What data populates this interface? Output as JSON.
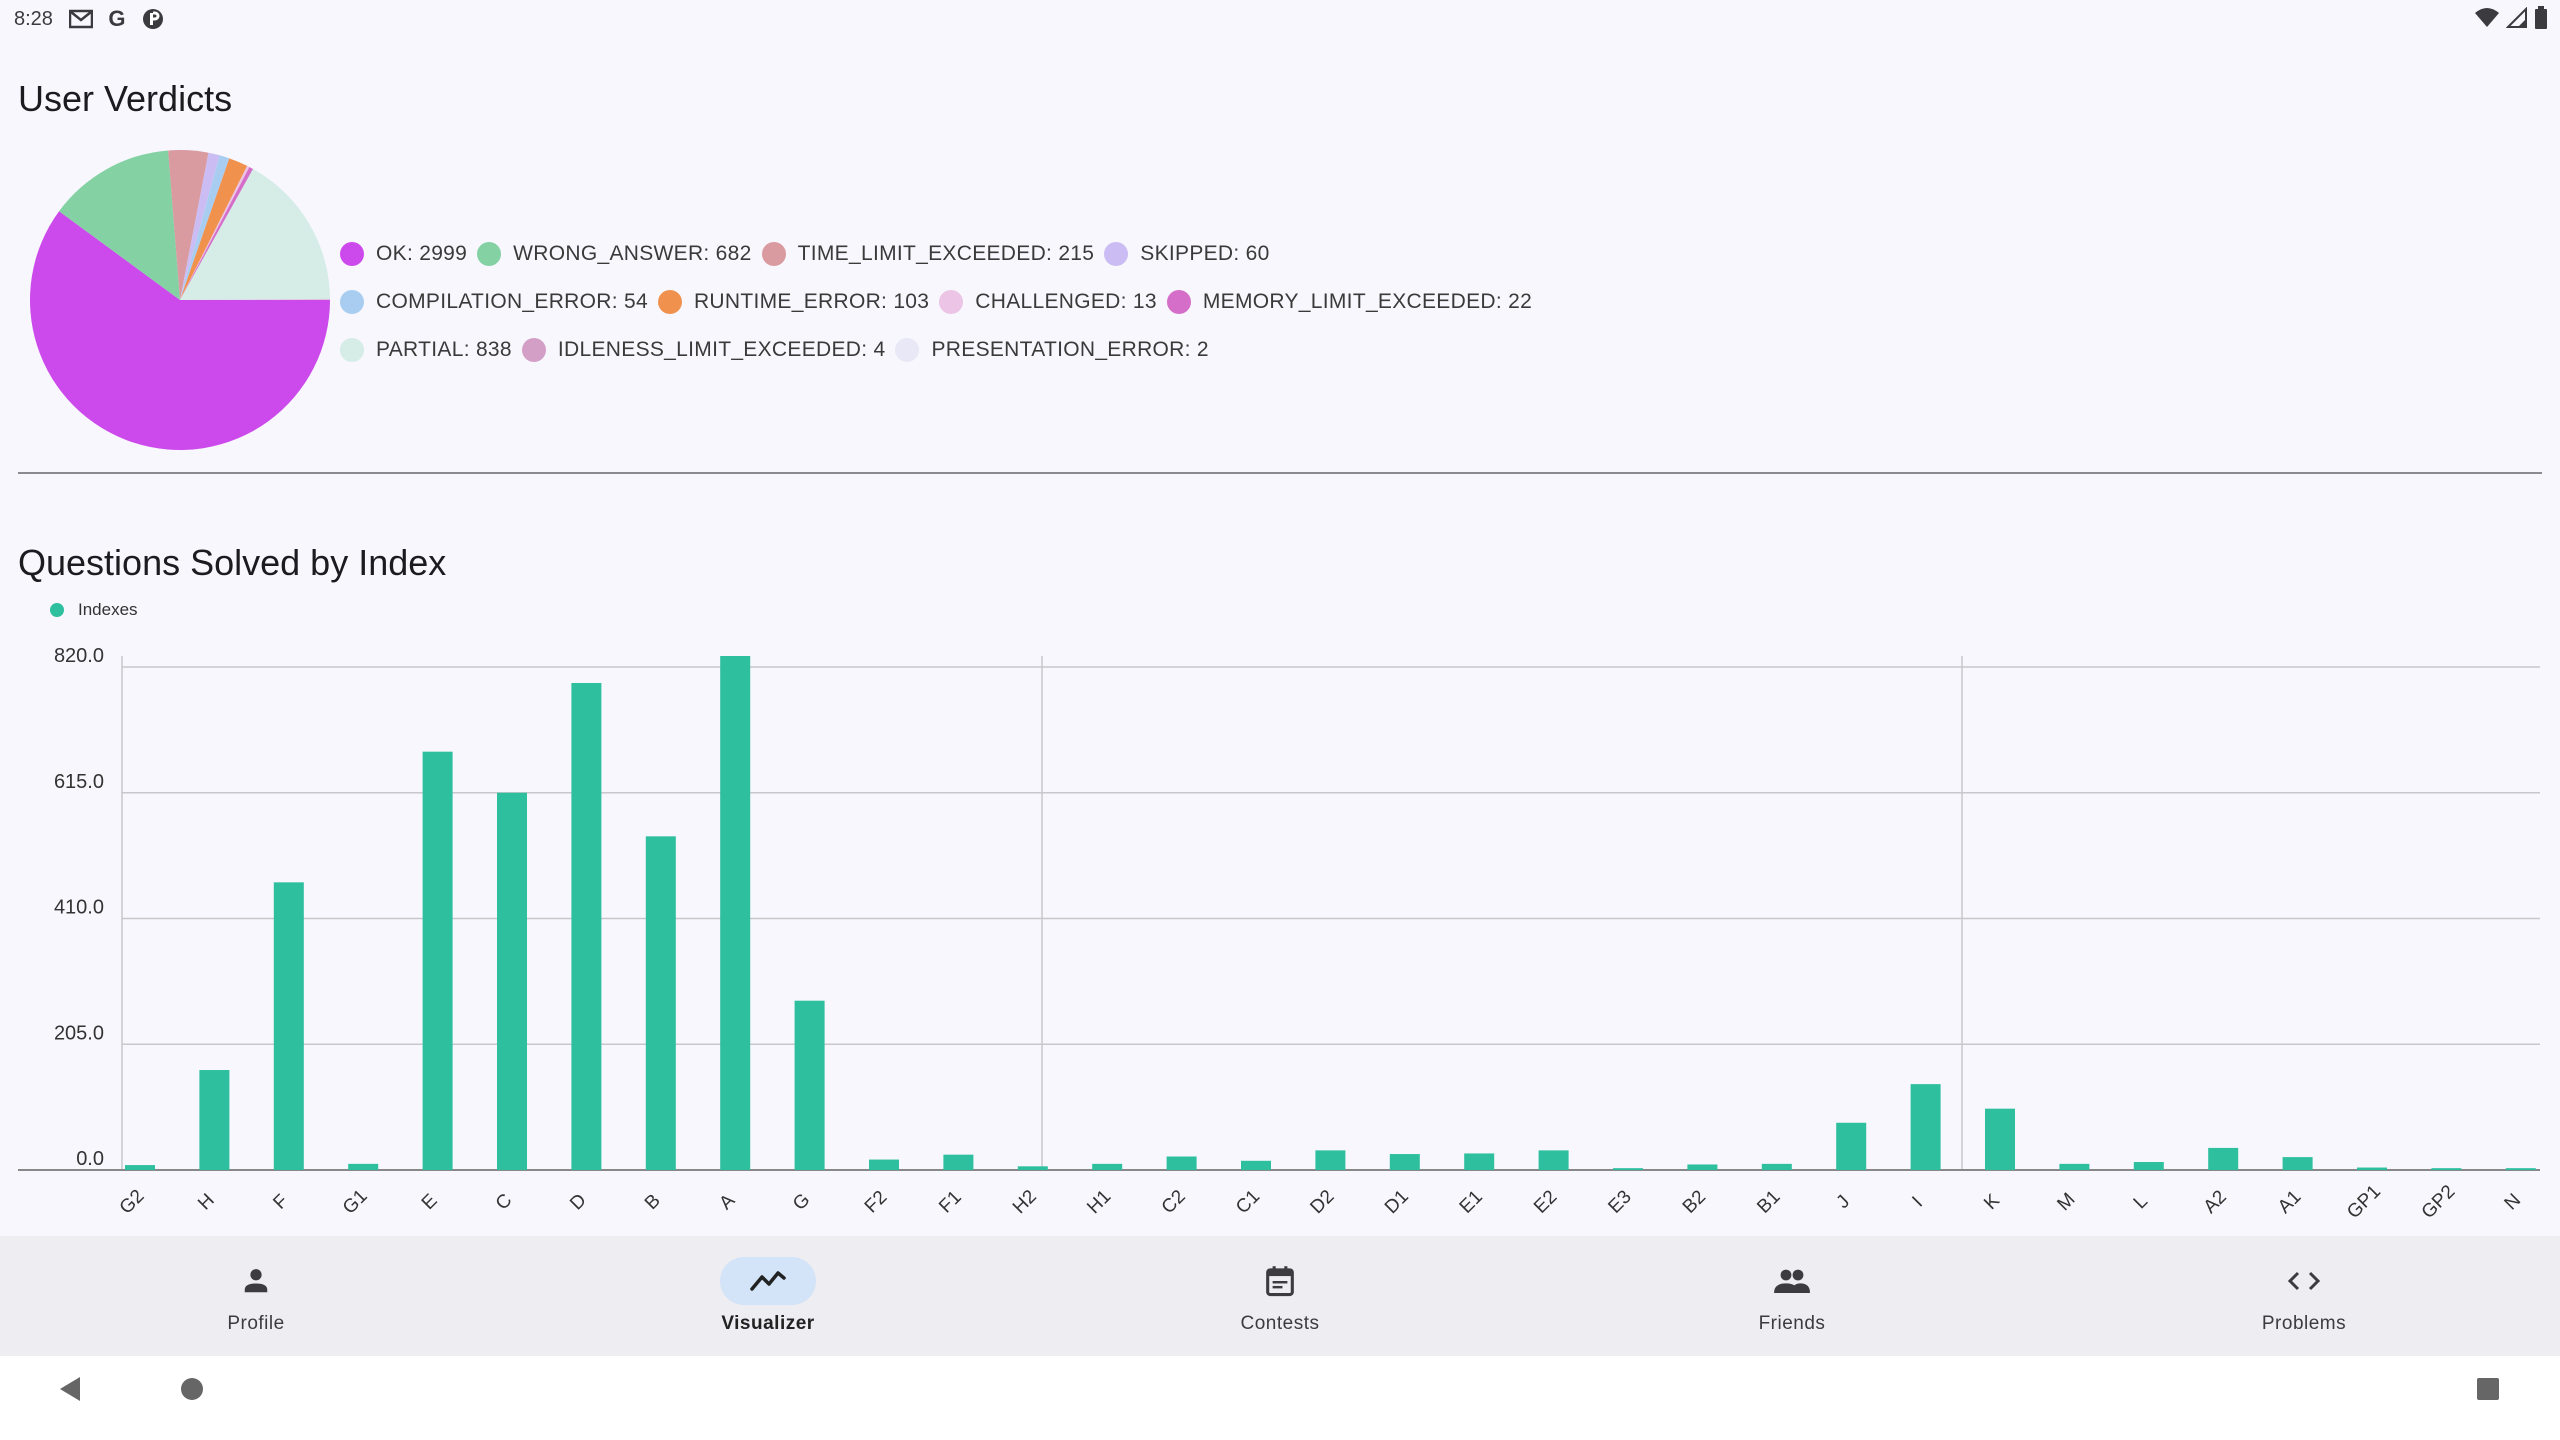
{
  "status_bar": {
    "time": "8:28",
    "left_icons": [
      "gmail-icon",
      "google-icon",
      "app-icon"
    ],
    "right_icons": [
      "wifi-icon",
      "signal-icon",
      "battery-icon"
    ]
  },
  "verdicts": {
    "title": "User Verdicts",
    "rows": [
      [
        {
          "label": "OK: 2999",
          "color": "#cc49eb"
        },
        {
          "label": "WRONG_ANSWER: 682",
          "color": "#84d1a3"
        },
        {
          "label": "TIME_LIMIT_EXCEEDED: 215",
          "color": "#d99aa0"
        },
        {
          "label": "SKIPPED: 60",
          "color": "#cbbdf3"
        }
      ],
      [
        {
          "label": "COMPILATION_ERROR: 54",
          "color": "#a9cdf0"
        },
        {
          "label": "RUNTIME_ERROR: 103",
          "color": "#f0924d"
        },
        {
          "label": "CHALLENGED: 13",
          "color": "#ecc4e6"
        },
        {
          "label": "MEMORY_LIMIT_EXCEEDED: 22",
          "color": "#d46ec8"
        }
      ],
      [
        {
          "label": "PARTIAL: 838",
          "color": "#d5ece7"
        },
        {
          "label": "IDLENESS_LIMIT_EXCEEDED: 4",
          "color": "#d49fc6"
        },
        {
          "label": "PRESENTATION_ERROR: 2",
          "color": "#e8e8f6"
        }
      ]
    ]
  },
  "questions": {
    "title": "Questions Solved by Index"
  },
  "chart_data": [
    {
      "type": "pie",
      "title": "User Verdicts",
      "slices": [
        {
          "name": "OK",
          "value": 2999,
          "color": "#cc49eb"
        },
        {
          "name": "WRONG_ANSWER",
          "value": 682,
          "color": "#84d1a3"
        },
        {
          "name": "TIME_LIMIT_EXCEEDED",
          "value": 215,
          "color": "#d99aa0"
        },
        {
          "name": "SKIPPED",
          "value": 60,
          "color": "#cbbdf3"
        },
        {
          "name": "COMPILATION_ERROR",
          "value": 54,
          "color": "#a9cdf0"
        },
        {
          "name": "RUNTIME_ERROR",
          "value": 103,
          "color": "#f0924d"
        },
        {
          "name": "CHALLENGED",
          "value": 13,
          "color": "#ecc4e6"
        },
        {
          "name": "MEMORY_LIMIT_EXCEEDED",
          "value": 22,
          "color": "#d46ec8"
        },
        {
          "name": "PARTIAL",
          "value": 838,
          "color": "#d5ece7"
        },
        {
          "name": "IDLENESS_LIMIT_EXCEEDED",
          "value": 4,
          "color": "#d49fc6"
        },
        {
          "name": "PRESENTATION_ERROR",
          "value": 2,
          "color": "#e8e8f6"
        }
      ],
      "legend_position": "right"
    },
    {
      "type": "bar",
      "title": "Questions Solved by Index",
      "categories": [
        "G2",
        "H",
        "F",
        "G1",
        "E",
        "C",
        "D",
        "B",
        "A",
        "G",
        "F2",
        "F1",
        "H2",
        "H1",
        "C2",
        "C1",
        "D2",
        "D1",
        "E1",
        "E2",
        "E3",
        "B2",
        "B1",
        "J",
        "I",
        "K",
        "M",
        "L",
        "A2",
        "A1",
        "GP1",
        "GP2",
        "N"
      ],
      "series": [
        {
          "name": "Indexes",
          "color": "#2dbf9e",
          "values": [
            8,
            163,
            469,
            10,
            682,
            615,
            794,
            544,
            838,
            276,
            17,
            25,
            6,
            10,
            22,
            15,
            32,
            26,
            27,
            32,
            3,
            9,
            10,
            77,
            140,
            100,
            10,
            13,
            36,
            21,
            4,
            3,
            3
          ]
        }
      ],
      "yticks": [
        "0.0",
        "205.0",
        "410.0",
        "615.0",
        "820.0"
      ],
      "ylim": [
        0,
        838
      ],
      "grid": true,
      "legend_position": "top-left"
    }
  ],
  "bottom_nav": {
    "items": [
      {
        "label": "Profile",
        "icon": "person-icon",
        "active": false
      },
      {
        "label": "Visualizer",
        "icon": "chart-line-icon",
        "active": true
      },
      {
        "label": "Contests",
        "icon": "calendar-icon",
        "active": false
      },
      {
        "label": "Friends",
        "icon": "people-icon",
        "active": false
      },
      {
        "label": "Problems",
        "icon": "code-icon",
        "active": false
      }
    ]
  }
}
